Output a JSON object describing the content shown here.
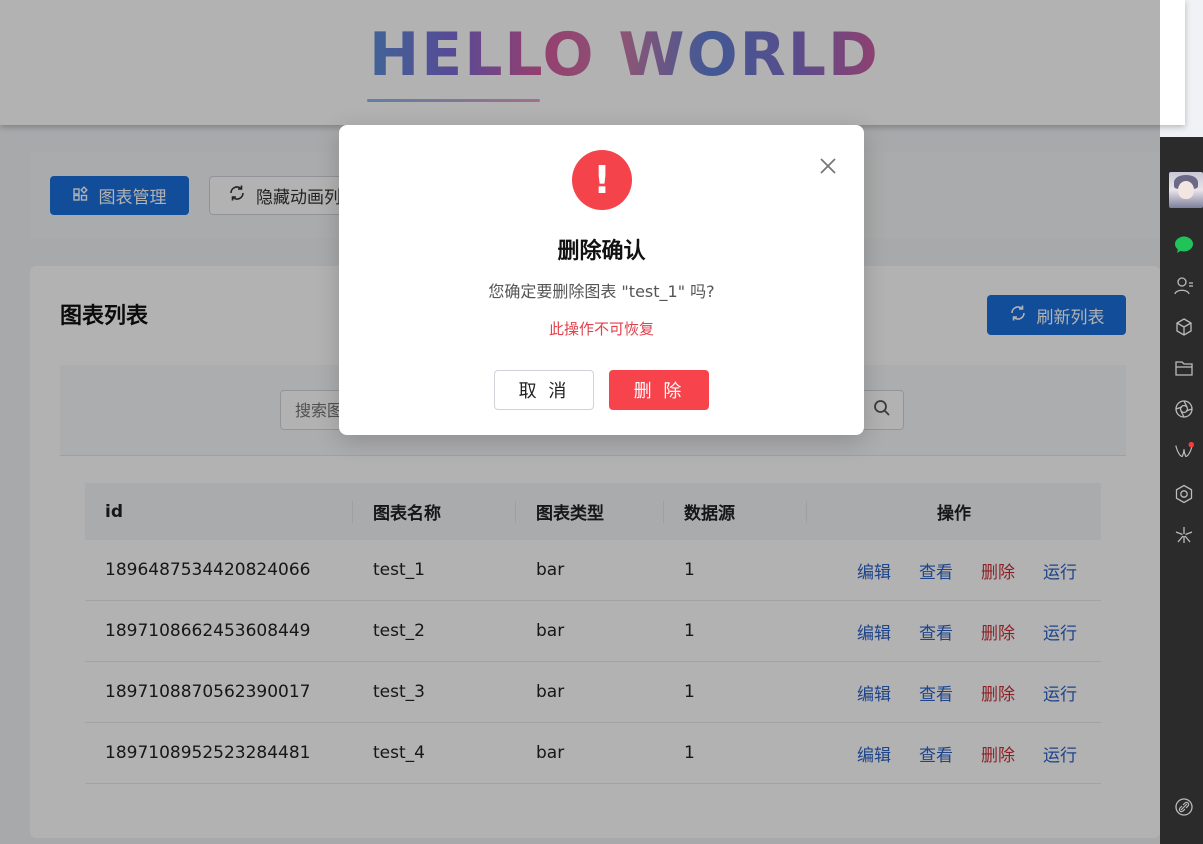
{
  "header": {
    "logo_text": "HELLO WORLD"
  },
  "toolbar": {
    "chart_manage_label": "图表管理",
    "hide_animation_label": "隐藏动画列"
  },
  "card": {
    "title": "图表列表",
    "refresh_label": "刷新列表",
    "search_placeholder": "搜索图表名称"
  },
  "table": {
    "columns": [
      "id",
      "图表名称",
      "图表类型",
      "数据源",
      "操作"
    ],
    "rows": [
      {
        "id": "1896487534420824066",
        "name": "test_1",
        "type": "bar",
        "source": "1"
      },
      {
        "id": "1897108662453608449",
        "name": "test_2",
        "type": "bar",
        "source": "1"
      },
      {
        "id": "1897108870562390017",
        "name": "test_3",
        "type": "bar",
        "source": "1"
      },
      {
        "id": "1897108952523284481",
        "name": "test_4",
        "type": "bar",
        "source": "1"
      }
    ],
    "actions": {
      "edit": "编辑",
      "view": "查看",
      "delete": "删除",
      "run": "运行"
    }
  },
  "modal": {
    "icon": "!",
    "title": "删除确认",
    "message": "您确定要删除图表 \"test_1\" 吗?",
    "warning": "此操作不可恢复",
    "cancel_label": "取 消",
    "delete_label": "删 除"
  },
  "colors": {
    "primary": "#1a6fdc",
    "danger": "#f6434c",
    "link": "#2c62c6",
    "sidebar": "#2b2b2b"
  }
}
